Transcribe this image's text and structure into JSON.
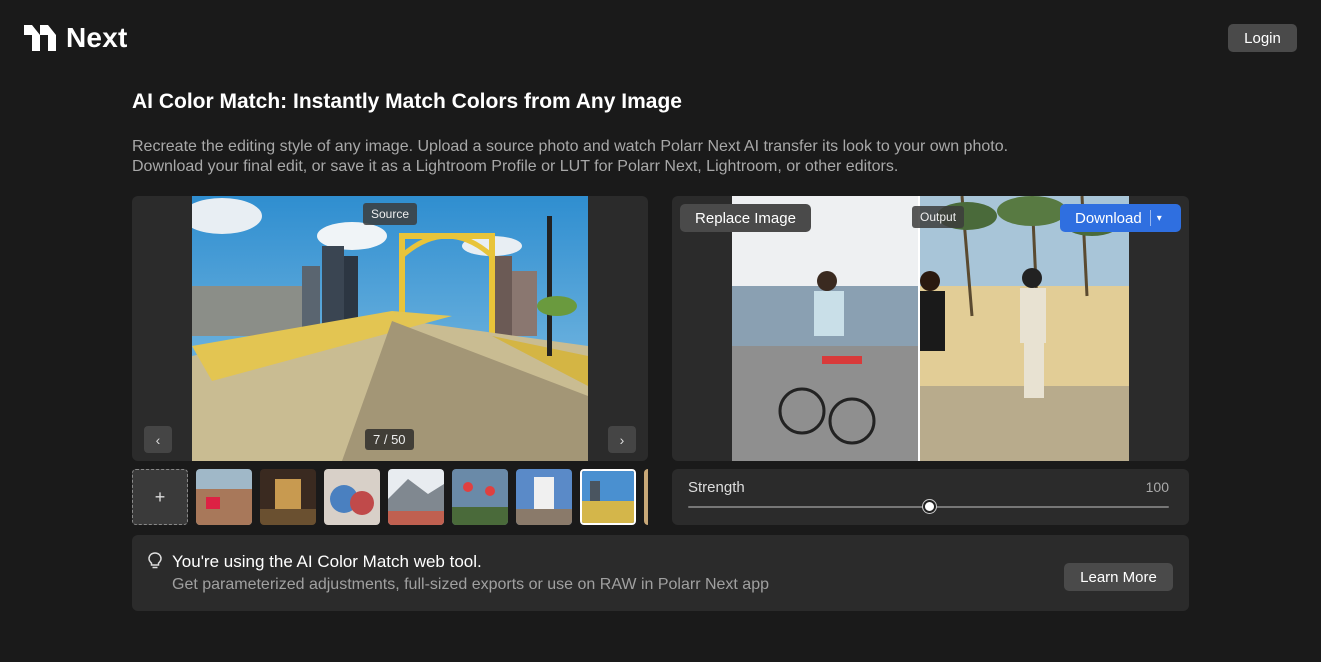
{
  "brand": {
    "name": "Next",
    "icon": "polarr-logo-icon"
  },
  "header": {
    "login_label": "Login"
  },
  "page": {
    "title": "AI Color Match: Instantly Match Colors from Any Image",
    "description": "Recreate the editing style of any image. Upload a source photo and watch Polarr Next AI transfer its look to your own photo. Download your final edit, or save it as a Lightroom Profile or LUT for Polarr Next, Lightroom, or other editors."
  },
  "source": {
    "badge": "Source",
    "counter": "7 / 50",
    "prev_icon": "chevron-left-icon",
    "next_icon": "chevron-right-icon"
  },
  "output": {
    "badge": "Output",
    "replace_label": "Replace Image",
    "download_label": "Download",
    "download_caret_icon": "chevron-down-icon"
  },
  "thumbnails": {
    "add_icon": "plus-icon",
    "add_label": "+",
    "selected_index": 6,
    "count_visible": 8
  },
  "strength": {
    "label": "Strength",
    "value": "100"
  },
  "info": {
    "icon": "lightbulb-icon",
    "title": "You're using the AI Color Match web tool.",
    "subtitle": "Get parameterized adjustments, full-sized exports or use on RAW in Polarr Next app",
    "learn_more_label": "Learn More"
  },
  "colors": {
    "background": "#1a1a1a",
    "panel": "#2b2b2b",
    "accent": "#2f6fe0",
    "button": "#4a4a4a"
  }
}
